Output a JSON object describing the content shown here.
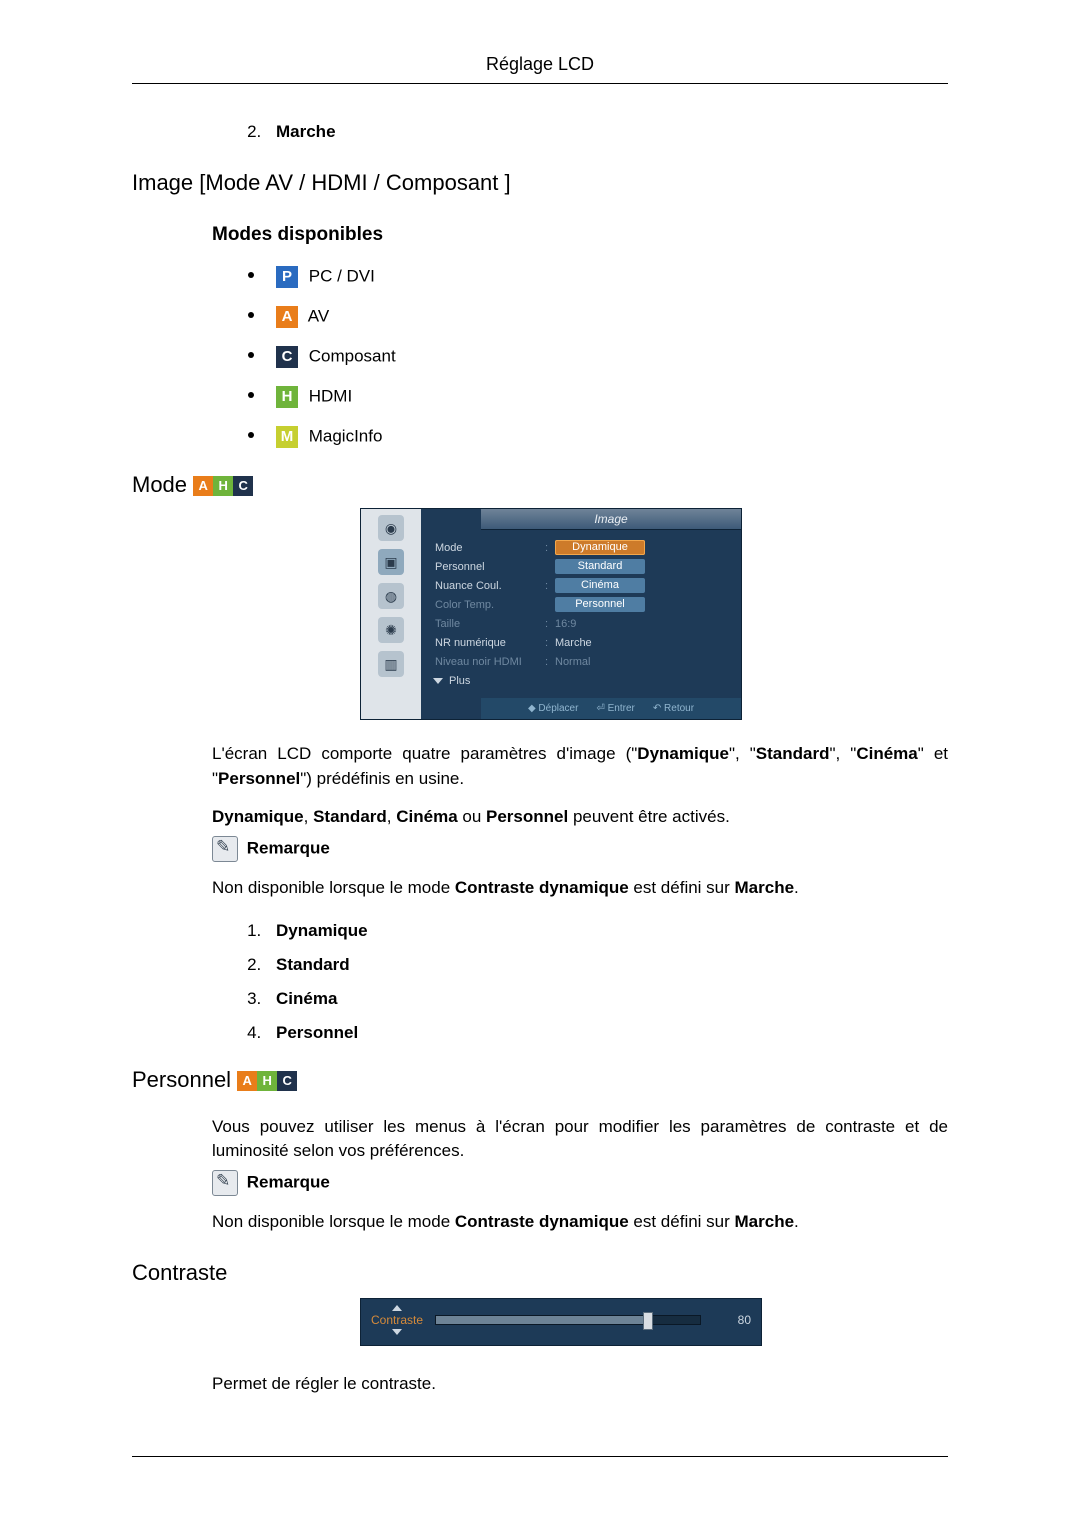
{
  "header": "Réglage LCD",
  "item2": "Marche",
  "sec_image": "Image [Mode AV / HDMI / Composant ]",
  "sub_modes": "Modes disponibles",
  "modes": {
    "p": "PC / DVI",
    "a": "AV",
    "c": "Composant",
    "h": "HDMI",
    "m": "MagicInfo"
  },
  "sec_mode": "Mode",
  "osd": {
    "title": "Image",
    "rows": {
      "mode_label": "Mode",
      "personnel": "Personnel",
      "nuance": "Nuance Coul.",
      "color_temp": "Color Temp.",
      "taille": "Taille",
      "taille_val": "16:9",
      "nr": "NR numérique",
      "nr_val": "Marche",
      "niveau": "Niveau noir HDMI",
      "niveau_val": "Normal",
      "plus": "Plus"
    },
    "options": {
      "dyn": "Dynamique",
      "std": "Standard",
      "cin": "Cinéma",
      "per": "Personnel"
    },
    "footer": {
      "move": "Déplacer",
      "enter": "Entrer",
      "return": "Retour"
    }
  },
  "para1_a": "L'écran LCD comporte quatre paramètres d'image (\"",
  "para1_b": "Dynamique",
  "para1_c": "\", \"",
  "para1_d": "Standard",
  "para1_e": "\", \"",
  "para1_f": "Cinéma",
  "para1_g": "\" et \"",
  "para1_h": "Personnel",
  "para1_i": "\") prédéfinis en usine.",
  "para2_a": "Dynamique",
  "para2_b": ", ",
  "para2_c": "Standard",
  "para2_d": ", ",
  "para2_e": "Cinéma",
  "para2_f": " ou ",
  "para2_g": "Personnel",
  "para2_h": " peuvent être activés.",
  "remark": "Remarque",
  "para3_a": "Non disponible lorsque le mode ",
  "para3_b": "Contraste dynamique",
  "para3_c": " est défini sur ",
  "para3_d": "Marche",
  "para3_e": ".",
  "ol": {
    "i1": "Dynamique",
    "i2": "Standard",
    "i3": "Cinéma",
    "i4": "Personnel"
  },
  "sec_personnel": "Personnel",
  "para4": "Vous pouvez utiliser les menus à l'écran pour modifier les paramètres de contraste et de luminosité selon vos préférences.",
  "sec_contraste": "Contraste",
  "slider": {
    "label": "Contraste",
    "value": "80"
  },
  "para5": "Permet de régler le contraste."
}
